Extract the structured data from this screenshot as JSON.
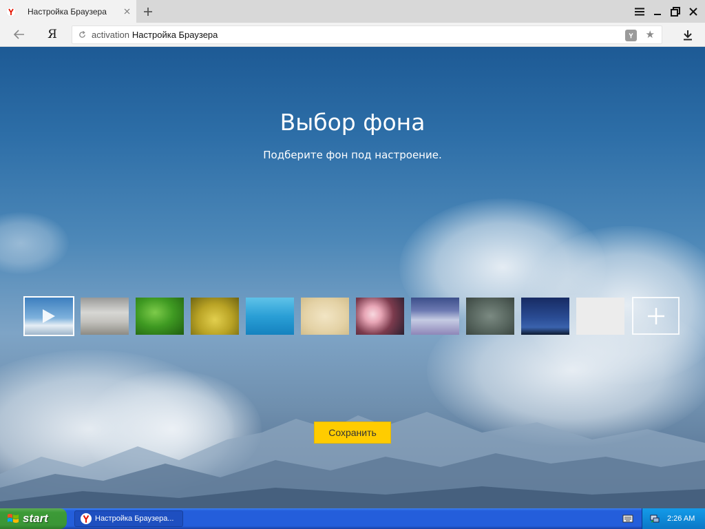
{
  "browser": {
    "tab": {
      "title": "Настройка Браузера"
    },
    "address": {
      "host": "activation",
      "title": "Настройка Браузера"
    },
    "yandex_button": "Я"
  },
  "page": {
    "title": "Выбор фона",
    "subtitle": "Подберите фон под настроение.",
    "save_label": "Сохранить",
    "accent_color": "#ffcc00",
    "thumbnails": [
      {
        "name": "sky-clouds-animated",
        "selected": true
      },
      {
        "name": "foggy-hills"
      },
      {
        "name": "green-grass"
      },
      {
        "name": "yellow-field"
      },
      {
        "name": "blue-sea"
      },
      {
        "name": "sand"
      },
      {
        "name": "cherry-blossom"
      },
      {
        "name": "snowy-mountain"
      },
      {
        "name": "rain-drops"
      },
      {
        "name": "night-forest"
      },
      {
        "name": "light-gray"
      }
    ]
  },
  "taskbar": {
    "start_label": "start",
    "task_label": "Настройка Браузера...",
    "clock": "2:26 AM"
  }
}
